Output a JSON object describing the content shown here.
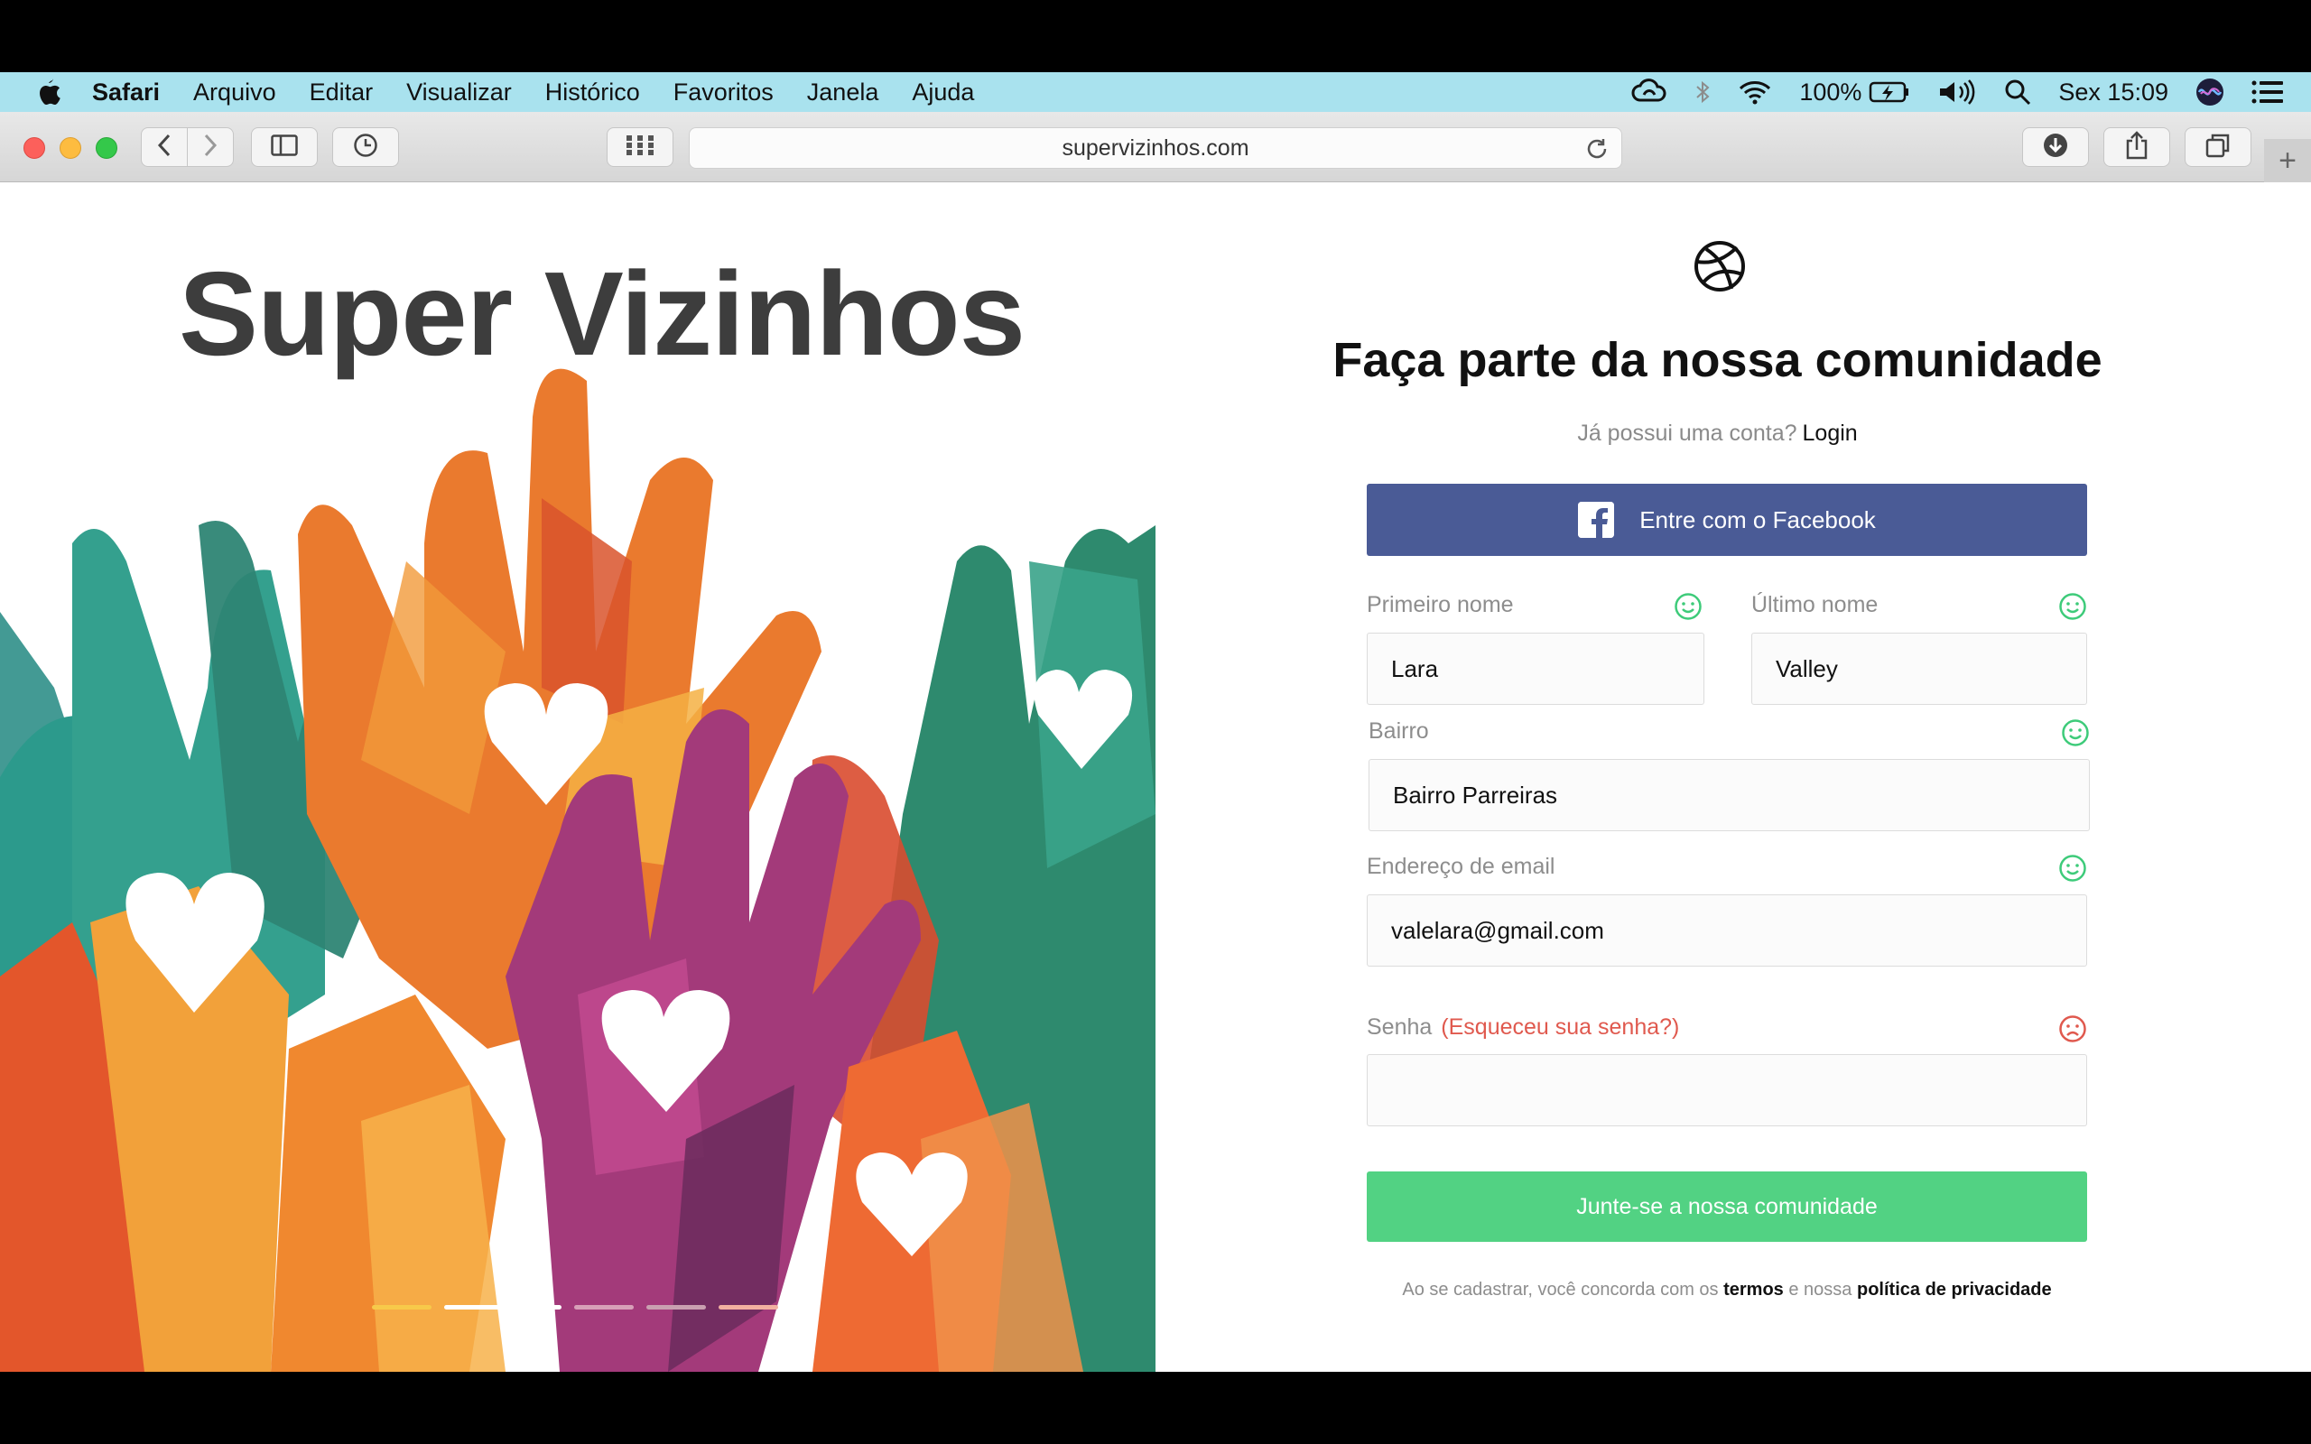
{
  "menubar": {
    "app_name": "Safari",
    "items": [
      "Arquivo",
      "Editar",
      "Visualizar",
      "Histórico",
      "Favoritos",
      "Janela",
      "Ajuda"
    ],
    "battery": "100%",
    "clock": "Sex 15:09",
    "icons": [
      "apple-icon",
      "creative-cloud-icon",
      "bluetooth-icon",
      "wifi-icon",
      "battery-icon",
      "volume-icon",
      "spotlight-icon",
      "siri-icon",
      "notification-center-icon"
    ]
  },
  "toolbar": {
    "url": "supervizinhos.com",
    "icons": [
      "back-icon",
      "forward-icon",
      "sidebar-icon",
      "history-icon",
      "top-sites-icon",
      "reload-icon",
      "downloads-icon",
      "share-icon",
      "tabs-overview-icon",
      "new-tab-icon"
    ],
    "new_tab": "+"
  },
  "hero": {
    "title": "Super Vizinhos",
    "slides_total": 5,
    "active_slide": 2
  },
  "form": {
    "heading": "Faça parte da nossa comunidade",
    "has_account": "Já possui uma conta?",
    "login_link": "Login",
    "facebook_button": "Entre com o Facebook",
    "first_name": {
      "label": "Primeiro nome",
      "value": "Lara",
      "status": "valid"
    },
    "last_name": {
      "label": "Último nome",
      "value": "Valley",
      "status": "valid"
    },
    "neighborhood": {
      "label": "Bairro",
      "value": "Bairro Parreiras",
      "status": "valid"
    },
    "email": {
      "label": "Endereço de email",
      "value": "valelara@gmail.com",
      "status": "valid"
    },
    "password": {
      "label": "Senha",
      "forgot": "(Esqueceu sua senha?)",
      "value": "",
      "status": "invalid"
    },
    "submit": "Junte-se a nossa comunidade",
    "terms_prefix": "Ao se cadastrar, você concorda com os",
    "terms_link": "termos",
    "terms_mid": "e nossa",
    "privacy_link": "política de privacidade"
  },
  "colors": {
    "menubar_bg": "#a9e2ee",
    "facebook": "#4a5b96",
    "submit": "#52d283",
    "valid": "#3ecb7a",
    "invalid": "#e0594e"
  }
}
